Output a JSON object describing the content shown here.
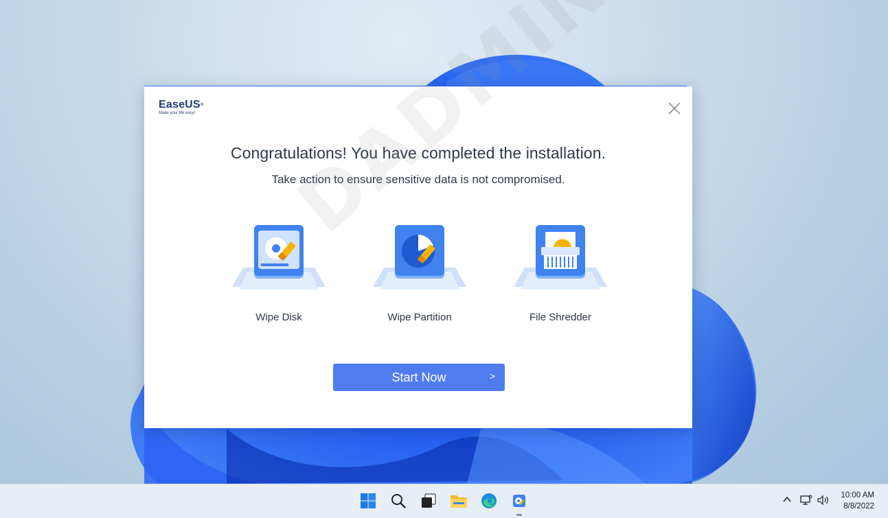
{
  "dialog": {
    "brand_name": "EaseUS",
    "brand_tagline": "Make your life easy!",
    "title": "Congratulations! You have completed the installation.",
    "subtitle": "Take action to ensure sensitive data is not compromised.",
    "features": [
      {
        "label": "Wipe Disk",
        "icon": "wipe-disk-icon"
      },
      {
        "label": "Wipe Partition",
        "icon": "wipe-partition-icon"
      },
      {
        "label": "File Shredder",
        "icon": "file-shredder-icon"
      }
    ],
    "start_button_label": "Start Now",
    "start_button_chevron": ">",
    "accent_color": "#4f7df0",
    "watermark": "DADMIN"
  },
  "taskbar": {
    "apps": [
      "windows-start-icon",
      "search-icon",
      "task-view-icon",
      "file-explorer-icon",
      "edge-browser-icon",
      "easeus-app-icon"
    ],
    "tray": {
      "time": "10:00 AM",
      "date": "8/8/2022"
    }
  }
}
